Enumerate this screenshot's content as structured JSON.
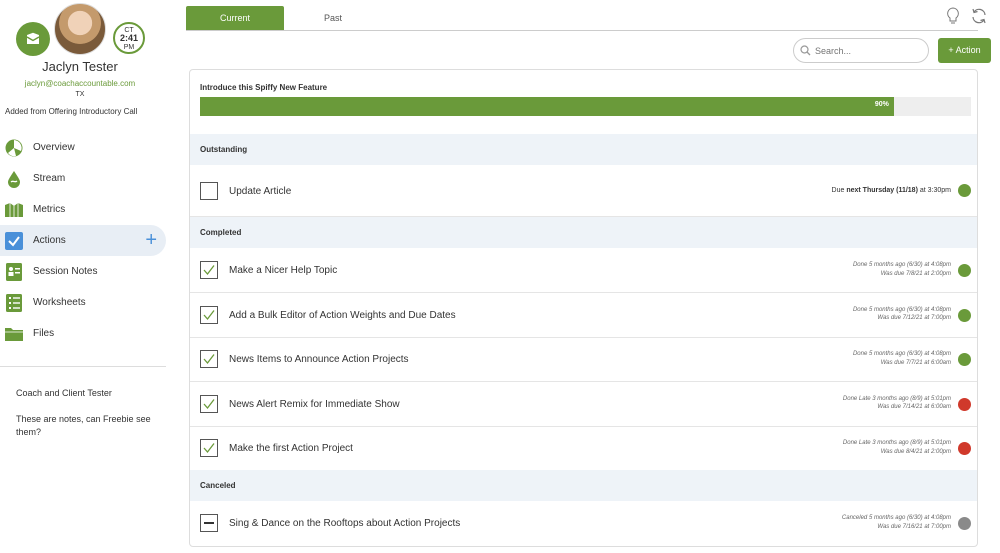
{
  "profile": {
    "name": "Jaclyn Tester",
    "email": "jaclyn@coachaccountable.com",
    "state": "TX",
    "added_from": "Added from Offering Introductory Call",
    "clock_tz": "CT",
    "clock_time": "2:41",
    "clock_ampm": "PM"
  },
  "nav": {
    "items": [
      {
        "label": "Overview",
        "icon": "overview-icon"
      },
      {
        "label": "Stream",
        "icon": "stream-icon"
      },
      {
        "label": "Metrics",
        "icon": "metrics-icon"
      },
      {
        "label": "Actions",
        "icon": "actions-icon"
      },
      {
        "label": "Session Notes",
        "icon": "session-notes-icon"
      },
      {
        "label": "Worksheets",
        "icon": "worksheets-icon"
      },
      {
        "label": "Files",
        "icon": "files-icon"
      }
    ],
    "plus": "+"
  },
  "sidebar_notes": {
    "coach": "Coach and Client Tester",
    "text": "These are notes, can Freebie see them?"
  },
  "tabs": {
    "current": "Current",
    "past": "Past"
  },
  "search": {
    "placeholder": "Search..."
  },
  "add_action": "+ Action",
  "project": {
    "title": "Introduce this Spiffy New Feature",
    "progress": 90,
    "progress_label": "90%"
  },
  "sections": {
    "outstanding": "Outstanding",
    "completed": "Completed",
    "canceled": "Canceled"
  },
  "outstanding": [
    {
      "label": "Update Article",
      "due_prefix": "Due ",
      "due_bold": "next Thursday (11/18)",
      "due_suffix": " at 3:30pm",
      "status": "#6a9a3a"
    }
  ],
  "completed": [
    {
      "label": "Make a Nicer Help Topic",
      "line1": "Done 5 months ago (6/30) at 4:08pm",
      "line2": "Was due 7/8/21 at 2:00pm",
      "status": "#6a9a3a"
    },
    {
      "label": "Add a Bulk Editor of Action Weights and Due Dates",
      "line1": "Done 5 months ago (6/30) at 4:08pm",
      "line2": "Was due 7/12/21 at 7:00pm",
      "status": "#6a9a3a"
    },
    {
      "label": "News Items to Announce Action Projects",
      "line1": "Done 5 months ago (6/30) at 4:08pm",
      "line2": "Was due 7/7/21 at 6:00am",
      "status": "#6a9a3a"
    },
    {
      "label": "News Alert Remix for Immediate Show",
      "line1": "Done Late 3 months ago (8/9) at 5:01pm",
      "line2": "Was due 7/14/21 at 6:00am",
      "status": "#d0392b"
    },
    {
      "label": "Make the first Action Project",
      "line1": "Done Late 3 months ago (8/9) at 5:01pm",
      "line2": "Was due 8/4/21 at 2:00pm",
      "status": "#d0392b"
    }
  ],
  "canceled": [
    {
      "label": "Sing & Dance on the Rooftops about Action Projects",
      "line1": "Canceled 5 months ago (6/30) at 4:08pm",
      "line2": "Was due 7/16/21 at 7:00pm",
      "status": "#8a8a8a"
    }
  ],
  "colors": {
    "accent": "#6a9a3a",
    "active_nav": "#e8eef5",
    "section_bg": "#eef3f8",
    "link": "#4a90d9"
  }
}
